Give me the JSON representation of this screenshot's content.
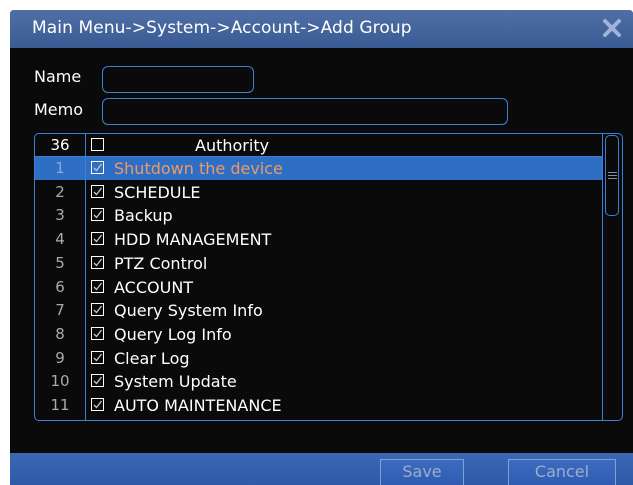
{
  "window": {
    "title": "Main Menu->System->Account->Add Group",
    "close_icon": "close-x-icon"
  },
  "form": {
    "name_label": "Name",
    "name_value": "",
    "memo_label": "Memo",
    "memo_value": ""
  },
  "list": {
    "header": {
      "count": "36",
      "column_title": "Authority",
      "checked": false
    },
    "selected_index": 0,
    "rows": [
      {
        "num": "1",
        "label": "Shutdown the device",
        "checked": true
      },
      {
        "num": "2",
        "label": "SCHEDULE",
        "checked": true
      },
      {
        "num": "3",
        "label": "Backup",
        "checked": true
      },
      {
        "num": "4",
        "label": "HDD MANAGEMENT",
        "checked": true
      },
      {
        "num": "5",
        "label": "PTZ Control",
        "checked": true
      },
      {
        "num": "6",
        "label": "ACCOUNT",
        "checked": true
      },
      {
        "num": "7",
        "label": "Query System Info",
        "checked": true
      },
      {
        "num": "8",
        "label": "Query Log Info",
        "checked": true
      },
      {
        "num": "9",
        "label": "Clear Log",
        "checked": true
      },
      {
        "num": "10",
        "label": "System Update",
        "checked": true
      },
      {
        "num": "11",
        "label": "AUTO MAINTENANCE",
        "checked": true
      }
    ]
  },
  "buttons": {
    "save": "Save",
    "cancel": "Cancel"
  },
  "colors": {
    "accent_border": "#3d7fd6",
    "selection": "#2f6ec5",
    "selected_text": "#ee9a62",
    "title_bar": "#4263a0"
  }
}
